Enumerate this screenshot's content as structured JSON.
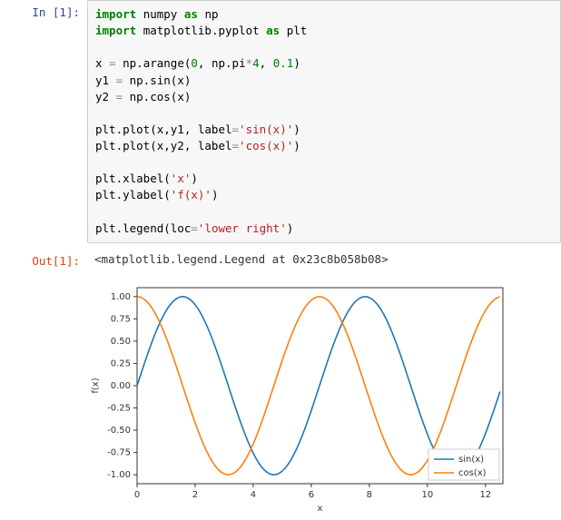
{
  "cell": {
    "in_prompt": "In [1]:",
    "out_prompt": "Out[1]:",
    "code": {
      "l1_import": "import",
      "l1_numpy": "numpy",
      "l1_as": "as",
      "l1_np": "np",
      "l2_import": "import",
      "l2_mpl": "matplotlib.pyplot",
      "l2_as": "as",
      "l2_plt": "plt",
      "l4_x": "x ",
      "l4_eq": "=",
      "l4_nparange": " np.arange(",
      "l4_zero": "0",
      "l4_c1": ", np.pi",
      "l4_star": "*",
      "l4_four": "4",
      "l4_c2": ", ",
      "l4_step": "0.1",
      "l4_close": ")",
      "l5_y1": "y1 ",
      "l5_eq": "=",
      "l5_rest": " np.sin(x)",
      "l6_y2": "y2 ",
      "l6_eq": "=",
      "l6_rest": " np.cos(x)",
      "l8_a": "plt.plot(x,y1, label",
      "l8_eq": "=",
      "l8_str": "'sin(x)'",
      "l8_close": ")",
      "l9_a": "plt.plot(x,y2, label",
      "l9_eq": "=",
      "l9_str": "'cos(x)'",
      "l9_close": ")",
      "l11_a": "plt.xlabel(",
      "l11_str": "'x'",
      "l11_close": ")",
      "l12_a": "plt.ylabel(",
      "l12_str": "'f(x)'",
      "l12_close": ")",
      "l14_a": "plt.legend(loc",
      "l14_eq": "=",
      "l14_str": "'lower right'",
      "l14_close": ")"
    },
    "output_text": "<matplotlib.legend.Legend at 0x23c8b058b08>"
  },
  "chart_data": {
    "type": "line",
    "xlabel": "x",
    "ylabel": "f(x)",
    "xlim": [
      0,
      12.6
    ],
    "ylim": [
      -1.1,
      1.1
    ],
    "xticks": [
      0,
      2,
      4,
      6,
      8,
      10,
      12
    ],
    "yticks": [
      -1.0,
      -0.75,
      -0.5,
      -0.25,
      0.0,
      0.25,
      0.5,
      0.75,
      1.0
    ],
    "legend_loc": "lower right",
    "series": [
      {
        "name": "sin(x)",
        "color": "#1f77b4",
        "x_start": 0,
        "x_step": 0.1,
        "n": 126,
        "fn": "sin"
      },
      {
        "name": "cos(x)",
        "color": "#ff7f0e",
        "x_start": 0,
        "x_step": 0.1,
        "n": 126,
        "fn": "cos"
      }
    ]
  }
}
